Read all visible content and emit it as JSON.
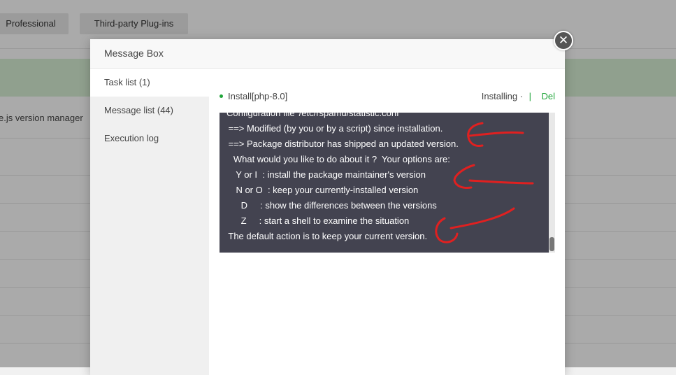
{
  "background": {
    "tabs": [
      "Professional",
      "Third-party Plug-ins"
    ],
    "row_text": "e.js version manager"
  },
  "dialog": {
    "title": "Message Box",
    "close_symbol": "✕",
    "sidebar": [
      {
        "label": "Task list (1)",
        "active": true
      },
      {
        "label": "Message list (44)",
        "active": false
      },
      {
        "label": "Execution log",
        "active": false
      }
    ],
    "task": {
      "name": "Install[php-8.0]",
      "status": "Installing ·",
      "separator": "|",
      "delete_label": "Del",
      "accent_color": "#20a53a"
    },
    "terminal": {
      "lines": [
        "Configuration file '/etc/rspamd/statistic.conf'",
        " ==> Modified (by you or by a script) since installation.",
        " ==> Package distributor has shipped an updated version.",
        "   What would you like to do about it ?  Your options are:",
        "    Y or I  : install the package maintainer's version",
        "    N or O  : keep your currently-installed version",
        "      D     : show the differences between the versions",
        "      Z     : start a shell to examine the situation",
        " The default action is to keep your current version."
      ]
    }
  }
}
